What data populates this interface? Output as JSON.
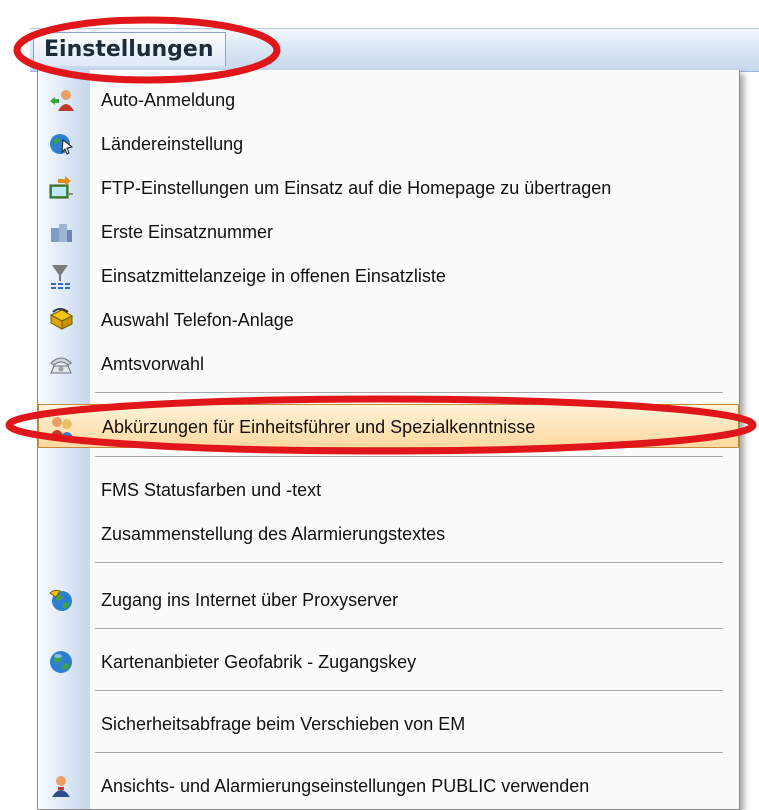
{
  "menu": {
    "title": "Einstellungen",
    "items": [
      {
        "label": "Auto-Anmeldung",
        "icon": "user-login-icon"
      },
      {
        "label": "Ländereinstellung",
        "icon": "globe-cursor-icon"
      },
      {
        "label": "FTP-Einstellungen um Einsatz auf die Homepage zu übertragen",
        "icon": "ftp-upload-icon"
      },
      {
        "label": "Erste Einsatznummer",
        "icon": "numbers-icon"
      },
      {
        "label": "Einsatzmittelanzeige in offenen Einsatzliste",
        "icon": "filter-icon"
      },
      {
        "label": "Auswahl Telefon-Anlage",
        "icon": "phone-system-icon"
      },
      {
        "label": "Amtsvorwahl",
        "icon": "telephone-icon"
      },
      {
        "label": "Abkürzungen für Einheitsführer und Spezialkenntnisse",
        "icon": "users-icon",
        "highlighted": true
      },
      {
        "label": "FMS Statusfarben und -text",
        "icon": ""
      },
      {
        "label": "Zusammenstellung des Alarmierungstextes",
        "icon": ""
      },
      {
        "label": "Zugang ins Internet über Proxyserver",
        "icon": "internet-proxy-icon"
      },
      {
        "label": "Kartenanbieter Geofabrik - Zugangskey",
        "icon": "globe-icon"
      },
      {
        "label": "Sicherheitsabfrage beim Verschieben von EM",
        "icon": ""
      },
      {
        "label": "Ansichts- und Alarmierungseinstellungen PUBLIC verwenden",
        "icon": "public-user-icon"
      }
    ]
  },
  "colors": {
    "annotation": "#e0161b",
    "highlight": "#ffd9a0"
  }
}
